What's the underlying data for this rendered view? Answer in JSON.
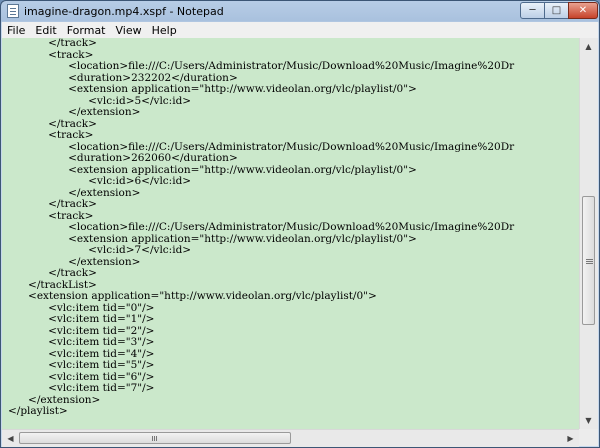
{
  "window": {
    "title": "imagine-dragon.mp4.xspf - Notepad"
  },
  "controls": {
    "minimize_icon": "minimize-icon",
    "maximize_icon": "maximize-icon",
    "close_icon": "close-icon"
  },
  "menu": [
    "File",
    "Edit",
    "Format",
    "View",
    "Help"
  ],
  "editor": {
    "background": "#cbe8cb",
    "lines": [
      "\t\t</track>",
      "\t\t<track>",
      "\t\t\t<location>file:///C:/Users/Administrator/Music/Download%20Music/Imagine%20Dr",
      "\t\t\t<duration>232202</duration>",
      "\t\t\t<extension application=\"http://www.videolan.org/vlc/playlist/0\">",
      "\t\t\t\t<vlc:id>5</vlc:id>",
      "\t\t\t</extension>",
      "\t\t</track>",
      "\t\t<track>",
      "\t\t\t<location>file:///C:/Users/Administrator/Music/Download%20Music/Imagine%20Dr",
      "\t\t\t<duration>262060</duration>",
      "\t\t\t<extension application=\"http://www.videolan.org/vlc/playlist/0\">",
      "\t\t\t\t<vlc:id>6</vlc:id>",
      "\t\t\t</extension>",
      "\t\t</track>",
      "\t\t<track>",
      "\t\t\t<location>file:///C:/Users/Administrator/Music/Download%20Music/Imagine%20Dr",
      "\t\t\t<extension application=\"http://www.videolan.org/vlc/playlist/0\">",
      "\t\t\t\t<vlc:id>7</vlc:id>",
      "\t\t\t</extension>",
      "\t\t</track>",
      "\t</trackList>",
      "\t<extension application=\"http://www.videolan.org/vlc/playlist/0\">",
      "\t\t<vlc:item tid=\"0\"/>",
      "\t\t<vlc:item tid=\"1\"/>",
      "\t\t<vlc:item tid=\"2\"/>",
      "\t\t<vlc:item tid=\"3\"/>",
      "\t\t<vlc:item tid=\"4\"/>",
      "\t\t<vlc:item tid=\"5\"/>",
      "\t\t<vlc:item tid=\"6\"/>",
      "\t\t<vlc:item tid=\"7\"/>",
      "\t</extension>",
      "</playlist>"
    ]
  },
  "scrollbars": {
    "vertical": {
      "position": 0.62,
      "visible_fraction": 0.36
    },
    "horizontal": {
      "position": 0.0,
      "visible_fraction": 0.5
    }
  }
}
